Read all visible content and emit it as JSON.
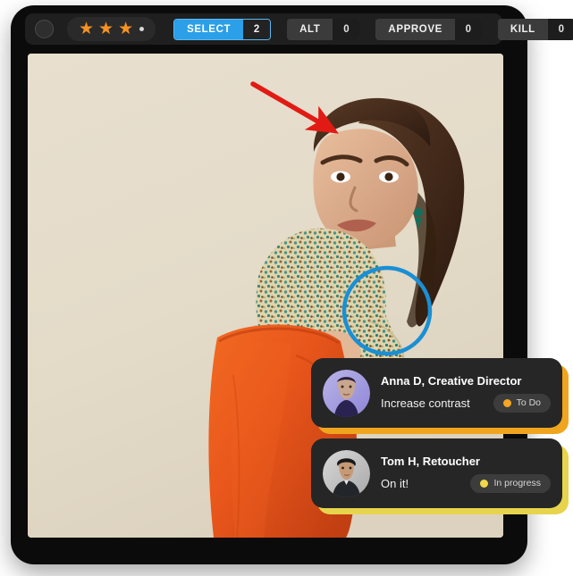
{
  "window": {
    "frame_color": "#0b0b0b"
  },
  "toolbar": {
    "menu_button_name": "circle-button",
    "rating": {
      "stars_filled": 3,
      "star_glyph": "★",
      "star_color": "#F59221",
      "trailing_dot": true
    },
    "segments": [
      {
        "label": "SELECT",
        "count": "2",
        "active": true,
        "accent": "#2b9fe8"
      },
      {
        "label": "ALT",
        "count": "0",
        "active": false,
        "accent": "#3b3b3b"
      },
      {
        "label": "APPROVE",
        "count": "0",
        "active": false,
        "accent": "#3b3b3b"
      },
      {
        "label": "KILL",
        "count": "0",
        "active": false,
        "accent": "#3b3b3b"
      }
    ]
  },
  "photo": {
    "alt": "Fashion model in floral blouse and orange trousers against beige backdrop",
    "background_color": "#E5DCCB",
    "trousers_color": "#E8561B"
  },
  "annotations": [
    {
      "type": "arrow",
      "name": "red-arrow-annotation",
      "color": "#E11B14",
      "points_at": "face"
    },
    {
      "type": "circle",
      "name": "blue-circle-annotation",
      "color": "#1A8FD4",
      "points_at": "sleeve"
    }
  ],
  "comments": [
    {
      "author": "Anna D, Creative Director",
      "message": "Increase contrast",
      "status": "To Do",
      "status_color": "#F5A623",
      "shadow_color": "#F0A51E",
      "avatar_name": "avatar-anna-d"
    },
    {
      "author": "Tom H, Retoucher",
      "message": "On it!",
      "status": "In progress",
      "status_color": "#F0D74A",
      "shadow_color": "#E8D44C",
      "avatar_name": "avatar-tom-h"
    }
  ]
}
